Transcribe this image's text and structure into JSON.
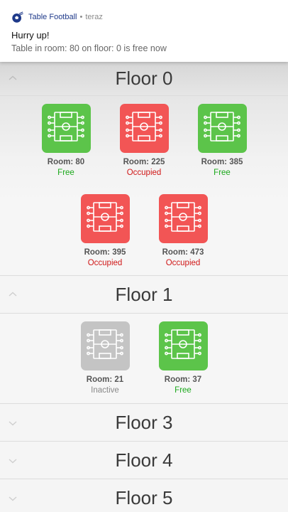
{
  "notification": {
    "app_name": "Table Football",
    "separator": "•",
    "time": "teraz",
    "title": "Hurry up!",
    "text": "Table in room: 80 on floor: 0 is free now",
    "icon": "soccer-ball-icon"
  },
  "floors": [
    {
      "title": "Floor 0",
      "expanded": true,
      "tables": [
        {
          "room": "Room: 80",
          "status": "Free",
          "state": "free"
        },
        {
          "room": "Room: 225",
          "status": "Occupied",
          "state": "occupied"
        },
        {
          "room": "Room: 385",
          "status": "Free",
          "state": "free"
        },
        {
          "room": "Room: 395",
          "status": "Occupied",
          "state": "occupied"
        },
        {
          "room": "Room: 473",
          "status": "Occupied",
          "state": "occupied"
        }
      ]
    },
    {
      "title": "Floor 1",
      "expanded": true,
      "tables": [
        {
          "room": "Room: 21",
          "status": "Inactive",
          "state": "inactive"
        },
        {
          "room": "Room: 37",
          "status": "Free",
          "state": "free"
        }
      ]
    },
    {
      "title": "Floor 3",
      "expanded": false
    },
    {
      "title": "Floor 4",
      "expanded": false
    },
    {
      "title": "Floor 5",
      "expanded": false
    }
  ],
  "colors": {
    "free": "#5cc44a",
    "occupied": "#f25555",
    "inactive": "#c4c4c4",
    "free_text": "#1aa81a",
    "occupied_text": "#d01818"
  }
}
